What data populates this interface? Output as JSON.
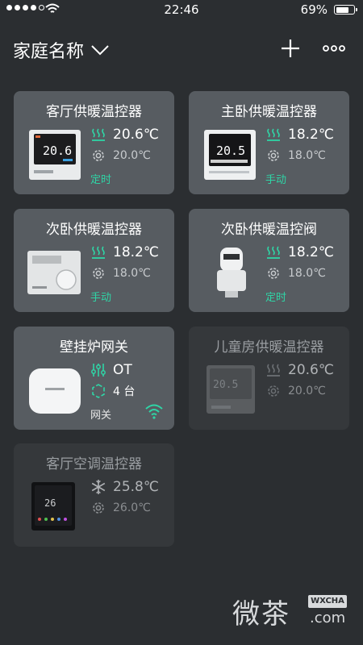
{
  "status_bar": {
    "time": "22:46",
    "battery": "69%"
  },
  "header": {
    "home_name": "家庭名称"
  },
  "devices": [
    {
      "name": "客厅供暖温控器",
      "current_temp": "20.6℃",
      "set_temp": "20.0℃",
      "mode": "定时",
      "screen": "20.6"
    },
    {
      "name": "主卧供暖温控器",
      "current_temp": "18.2℃",
      "set_temp": "18.0℃",
      "mode": "手动",
      "screen": "20.5"
    },
    {
      "name": "次卧供暖温控器",
      "current_temp": "18.2℃",
      "set_temp": "18.0℃",
      "mode": "手动"
    },
    {
      "name": "次卧供暖温控阀",
      "current_temp": "18.2℃",
      "set_temp": "18.0℃",
      "mode": "定时"
    },
    {
      "name": "壁挂炉网关",
      "protocol": "OT",
      "device_count": "4 台",
      "mode": "网关"
    },
    {
      "name": "儿童房供暖温控器",
      "current_temp": "20.6℃",
      "set_temp": "20.0℃",
      "screen": "20.5"
    },
    {
      "name": "客厅空调温控器",
      "current_temp": "25.8℃",
      "set_temp": "26.0℃",
      "screen": "26"
    }
  ],
  "watermark": {
    "zh": "微茶",
    "badge": "WXCHA",
    "com": ".com"
  },
  "colors": {
    "background": "#2b2e31",
    "card": "#575c61",
    "card_offline": "#35383b",
    "accent": "#2fd5a6"
  },
  "icons": [
    "heating-icon",
    "gear-icon",
    "plus-icon",
    "more-icon",
    "chevron-down-icon",
    "wifi-icon",
    "snowflake-icon",
    "sliders-icon",
    "link-icon"
  ]
}
